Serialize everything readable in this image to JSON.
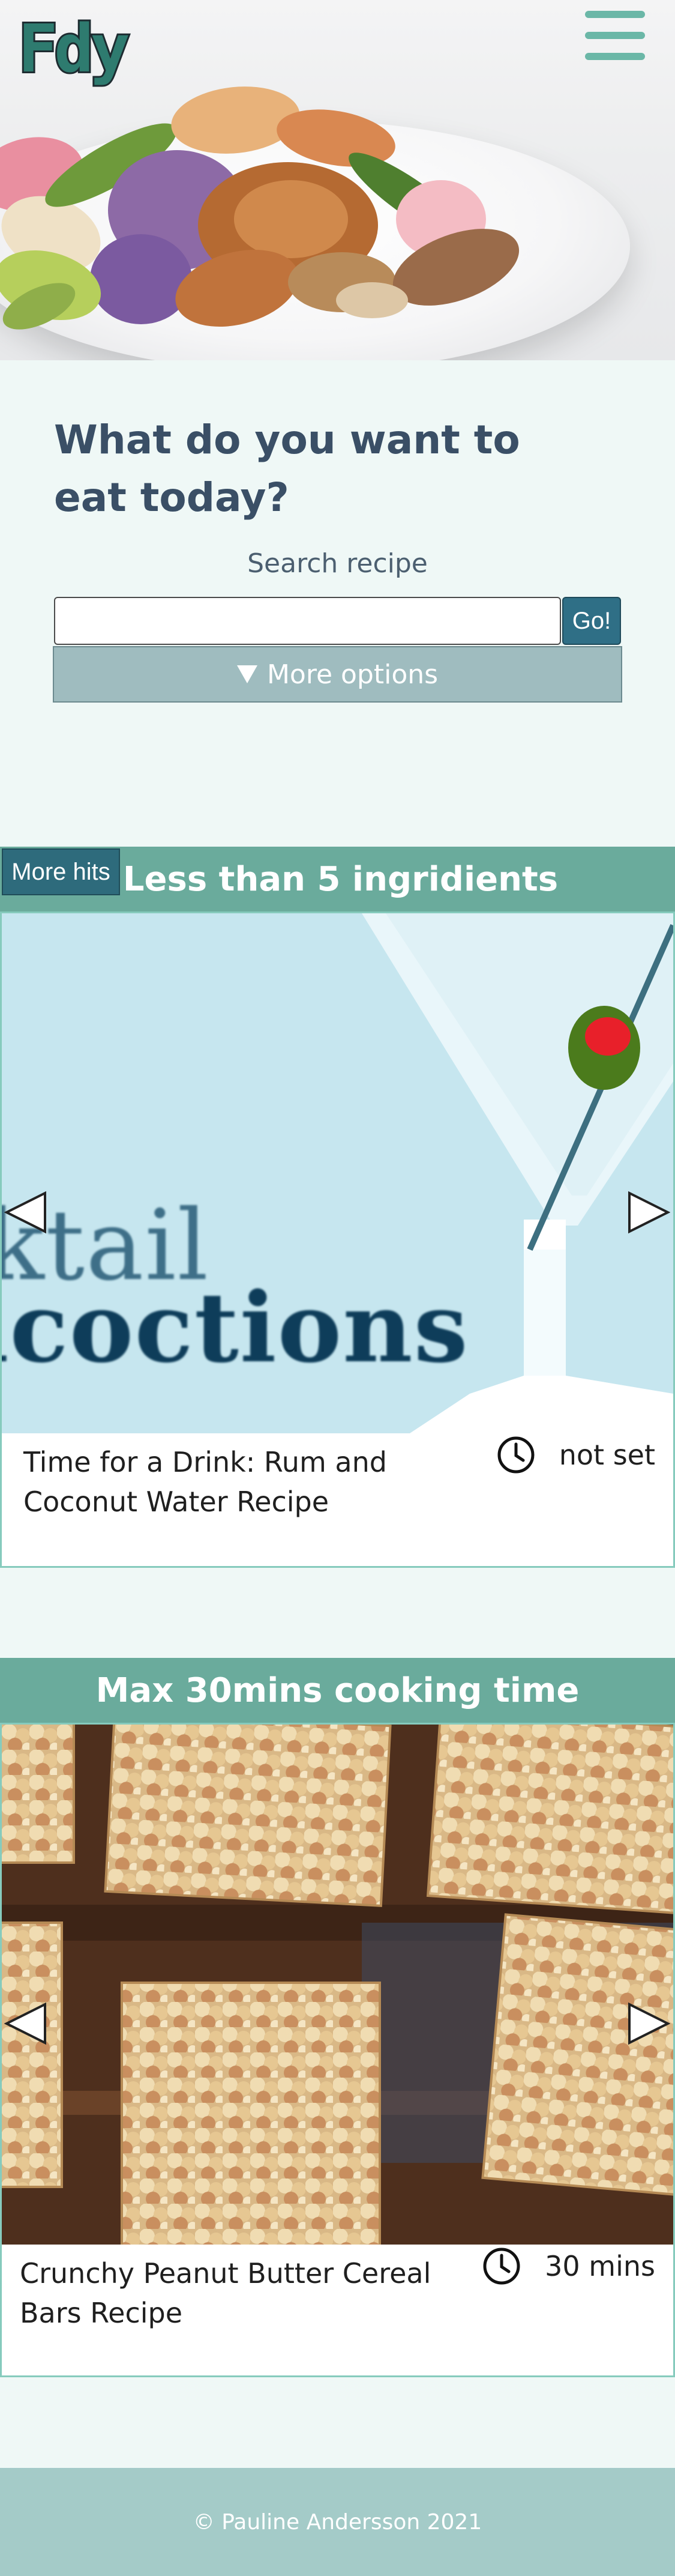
{
  "header": {
    "logo_text": "Fdy",
    "menu_icon": "hamburger-menu-icon",
    "hero_image": "shrimp and vegetable stir-fry on a white plate"
  },
  "search": {
    "title": "What do you want to eat today?",
    "label": "Search recipe",
    "input_value": "",
    "go_label": "Go!",
    "more_options_label": "More options",
    "more_options_icon": "triangle-down-icon"
  },
  "carousels": [
    {
      "heading": "Less than 5 ingridients",
      "more_hits_label": "More hits",
      "recipe": {
        "image_text_line1": "cktail",
        "image_text_line2": "ncoctions",
        "title": "Time for a Drink: Rum and Coconut Water Recipe",
        "time": "not set"
      }
    },
    {
      "heading": "Max 30mins cooking time",
      "recipe": {
        "title": "Crunchy Peanut Butter Cereal Bars Recipe",
        "time": "30 mins"
      }
    }
  ],
  "footer": {
    "copyright": "© Pauline Andersson 2021"
  },
  "colors": {
    "page_bg": "#eff8f6",
    "accent": "#6aab9c",
    "dark_button": "#2e6b7c",
    "heading_text": "#3a4f66",
    "footer_bg": "#a4cbc8"
  }
}
